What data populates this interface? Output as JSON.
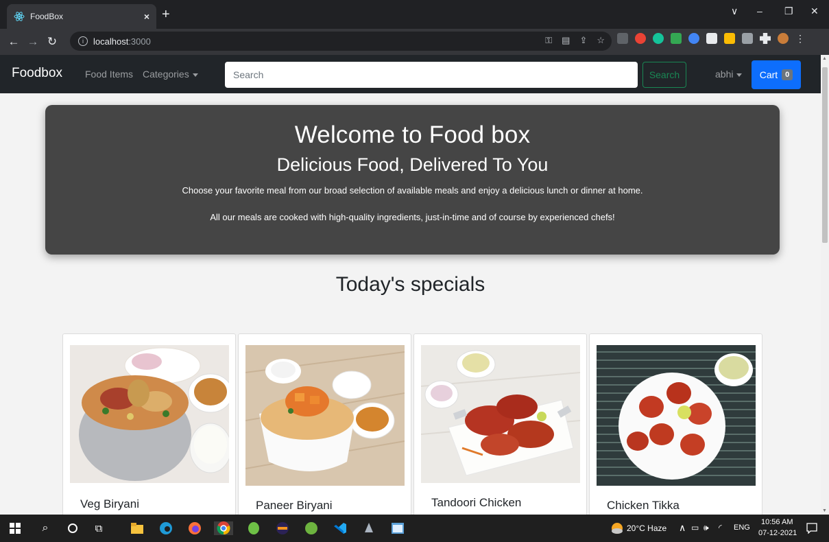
{
  "browser": {
    "tab_title": "FoodBox",
    "tab_close": "×",
    "new_tab": "+",
    "url_host": "localhost",
    "url_port": ":3000",
    "window_controls": [
      "∨",
      "–",
      "❐",
      "✕"
    ]
  },
  "navbar": {
    "brand": "Foodbox",
    "food_items": "Food Items",
    "categories": "Categories",
    "search_placeholder": "Search",
    "search_button": "Search",
    "user": "abhi",
    "cart_label": "Cart",
    "cart_count": "0"
  },
  "hero": {
    "title": "Welcome to Food box",
    "subtitle": "Delicious Food, Delivered To You",
    "line1": "Choose your favorite meal from our broad selection of available meals and enjoy a delicious lunch or dinner at home.",
    "line2": "All our meals are cooked with high-quality ingredients, just-in-time and of course by experienced chefs!"
  },
  "specials": {
    "title": "Today's specials",
    "items": [
      {
        "name": "Veg Biryani"
      },
      {
        "name": "Paneer Biryani"
      },
      {
        "name": "Tandoori Chicken"
      },
      {
        "name": "Chicken Tikka"
      }
    ]
  },
  "taskbar": {
    "weather": "20°C  Haze",
    "language": "ENG",
    "time": "10:56 AM",
    "date": "07-12-2021"
  }
}
